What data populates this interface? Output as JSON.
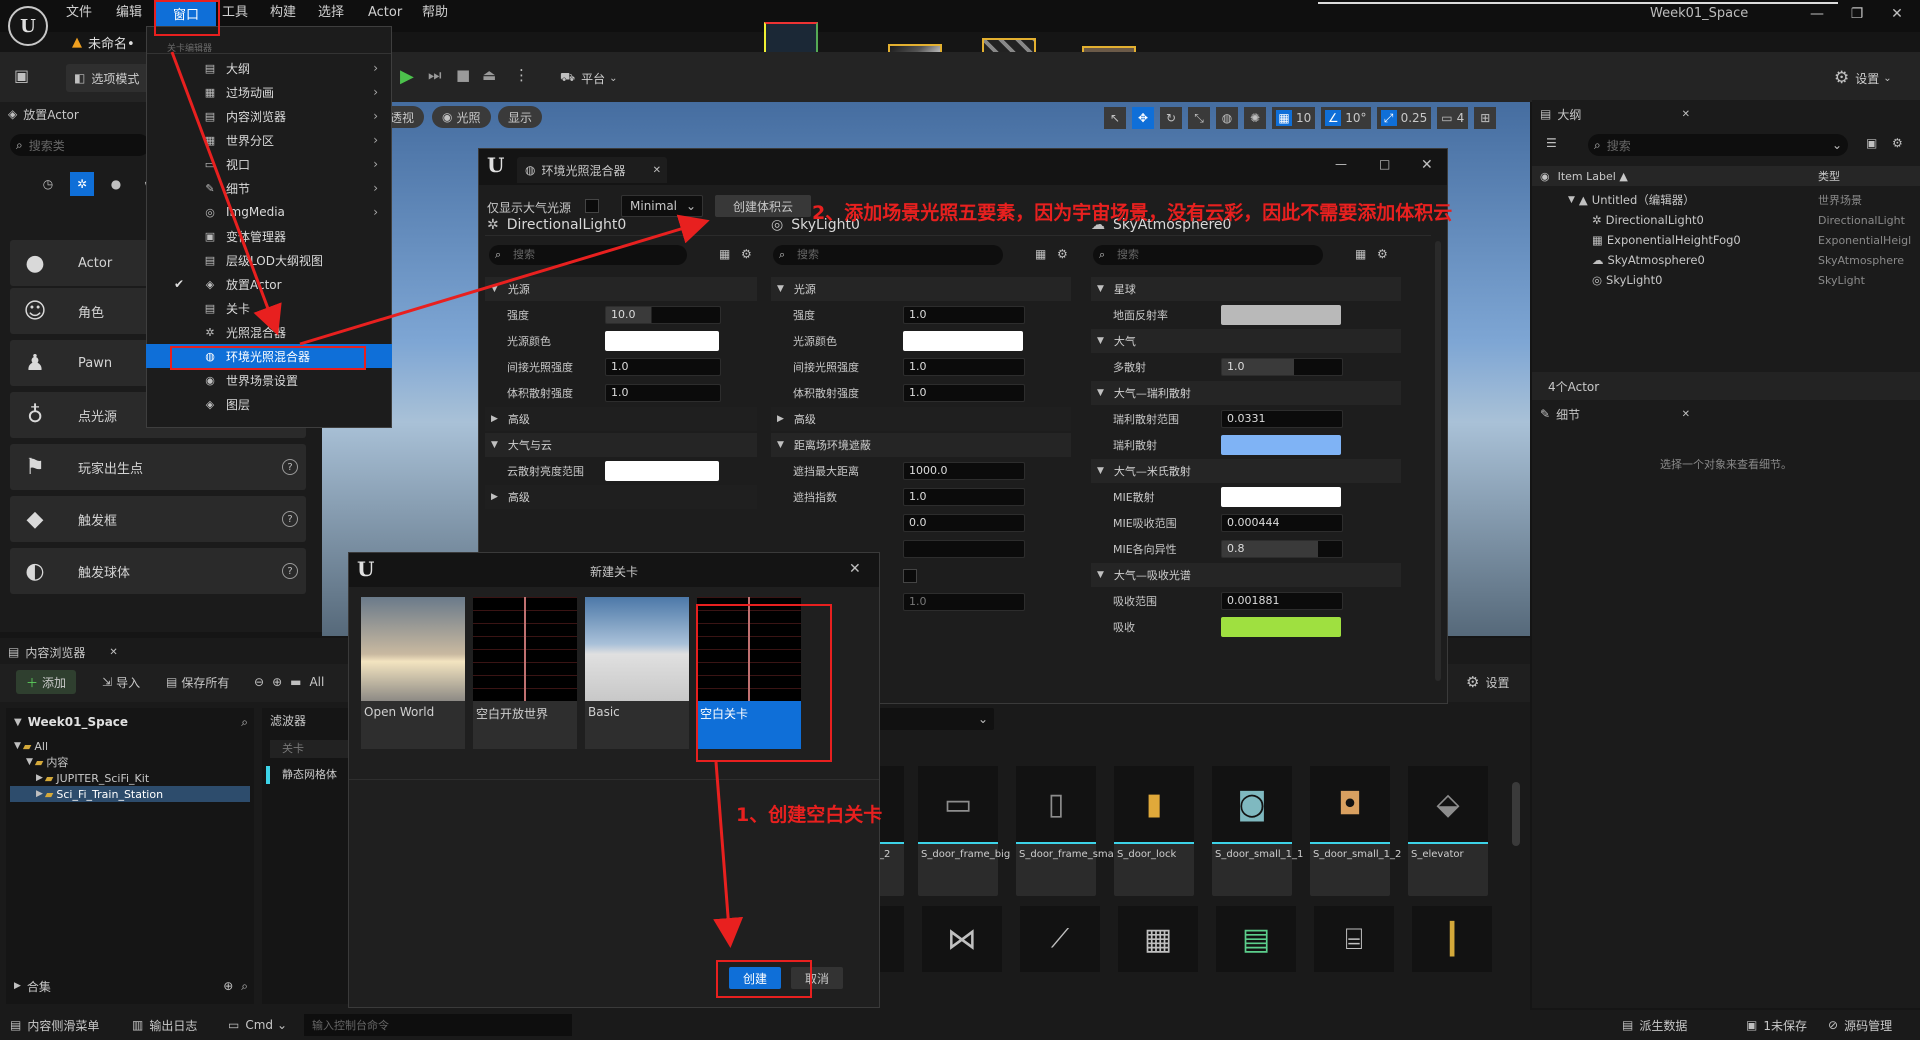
{
  "menubar": {
    "items": [
      "文件",
      "编辑",
      "窗口",
      "工具",
      "构建",
      "选择",
      "Actor",
      "帮助"
    ]
  },
  "window_title": "Week01_Space",
  "doc_tab": "未命名•",
  "toolbar": {
    "mode": "选项模式",
    "platform": "平台",
    "settings": "设置"
  },
  "viewport": {
    "perspective": "透视",
    "lit": "光照",
    "show": "显示",
    "grid": "10",
    "angle": "10°",
    "scale": "0.25",
    "camera": "4"
  },
  "place": {
    "title": "放置Actor",
    "search": "搜索类",
    "items": [
      "Actor",
      "角色",
      "Pawn",
      "点光源",
      "玩家出生点",
      "触发框",
      "触发球体"
    ]
  },
  "window_menu": {
    "header": "关卡编辑器",
    "items": [
      "大纲",
      "过场动画",
      "内容浏览器",
      "世界分区",
      "视口",
      "细节",
      "ImgMedia",
      "变体管理器",
      "层级LOD大纲视图",
      "放置Actor",
      "关卡",
      "光照混合器",
      "环境光照混合器",
      "世界场景设置",
      "图层"
    ]
  },
  "env_dialog": {
    "title": "环境光照混合器",
    "only_atmosphere": "仅显示大气光源",
    "mode": "Minimal",
    "create_cloud": "创建体积云",
    "search": "搜索",
    "dir": {
      "name": "DirectionalLight0",
      "sec_light": "光源",
      "intensity_l": "强度",
      "intensity": "10.0",
      "color_l": "光源颜色",
      "indirect_l": "间接光照强度",
      "indirect": "1.0",
      "volscatter_l": "体积散射强度",
      "volscatter": "1.0",
      "advanced": "高级",
      "atmo_cloud": "大气与云",
      "cloud_scatter_l": "云散射亮度范围",
      "advanced2": "高级"
    },
    "sky": {
      "name": "SkyLight0",
      "sec_light": "光源",
      "intensity_l": "强度",
      "intensity": "1.0",
      "color_l": "光源颜色",
      "indirect_l": "间接光照强度",
      "indirect": "1.0",
      "volscatter_l": "体积散射强度",
      "volscatter": "1.0",
      "advanced": "高级",
      "dfao": "距离场环境遮蔽",
      "occl_dist_l": "遮挡最大距离",
      "occl_dist": "1000.0",
      "occl_exp_l": "遮挡指数",
      "occl_exp": "1.0",
      "v3": "0.0",
      "v4": "1.0"
    },
    "atm": {
      "name": "SkyAtmosphere0",
      "sec_planet": "星球",
      "ground_albedo_l": "地面反射率",
      "sec_atm": "大气",
      "multi_l": "多散射",
      "multi": "1.0",
      "sec_rayleigh": "大气—瑞利散射",
      "ray_range_l": "瑞利散射范围",
      "ray_range": "0.0331",
      "ray_scat_l": "瑞利散射",
      "sec_mie": "大气—米氏散射",
      "mie_scat_l": "MIE散射",
      "mie_abs_l": "MIE吸收范围",
      "mie_abs": "0.000444",
      "mie_aniso_l": "MIE各向异性",
      "mie_aniso": "0.8",
      "sec_absorb": "大气—吸收光谱",
      "abs_range_l": "吸收范围",
      "abs_range": "0.001881",
      "abs_l": "吸收"
    }
  },
  "new_level": {
    "title": "新建关卡",
    "templates": [
      "Open World",
      "空白开放世界",
      "Basic",
      "空白关卡"
    ],
    "create": "创建",
    "cancel": "取消"
  },
  "content_browser": {
    "title": "内容浏览器",
    "add": "添加",
    "import": "导入",
    "save_all": "保存所有",
    "all": "All",
    "root": "Week01_Space",
    "filters": "滤波器",
    "filter_level": "关卡",
    "filter_static": "静态网格体",
    "tree": [
      "All",
      "内容",
      "JUPITER_SciFi_Kit",
      "Sci_Fi_Train_Station"
    ],
    "collections": "合集",
    "settings": "设置",
    "assets": [
      "_2",
      "S_door_frame_big",
      "S_door_frame_small",
      "S_door_lock",
      "S_door_small_1_1",
      "S_door_small_1_2",
      "S_elevator"
    ]
  },
  "outliner": {
    "title": "大纲",
    "search": "搜索",
    "col_label": "Item Label ▲",
    "col_type": "类型",
    "rows": [
      {
        "label": "Untitled（编辑器）",
        "type": "世界场景"
      },
      {
        "label": "DirectionalLight0",
        "type": "DirectionalLight"
      },
      {
        "label": "ExponentialHeightFog0",
        "type": "ExponentialHeigl"
      },
      {
        "label": "SkyAtmosphere0",
        "type": "SkyAtmosphere"
      },
      {
        "label": "SkyLight0",
        "type": "SkyLight"
      }
    ],
    "count": "4个Actor"
  },
  "details": {
    "title": "细节",
    "empty": "选择一个对象来查看细节。"
  },
  "statusbar": {
    "drawer": "内容侧滑菜单",
    "output": "输出日志",
    "cmd": "Cmd",
    "console": "输入控制台命令",
    "source": "派生数据",
    "unsaved": "1未保存",
    "scm": "源码管理"
  },
  "annotations": {
    "step1": "1、创建空白关卡",
    "step2": "2、添加场景光照五要素，因为宇宙场景，没有云彩，因此不需要添加体积云"
  },
  "colors": {
    "accent": "#0f6fd8",
    "annotation": "#e8201f",
    "ray_color": "#7fb3f5",
    "absorb_color": "#9fe040",
    "ground": "#b9b9b9"
  }
}
